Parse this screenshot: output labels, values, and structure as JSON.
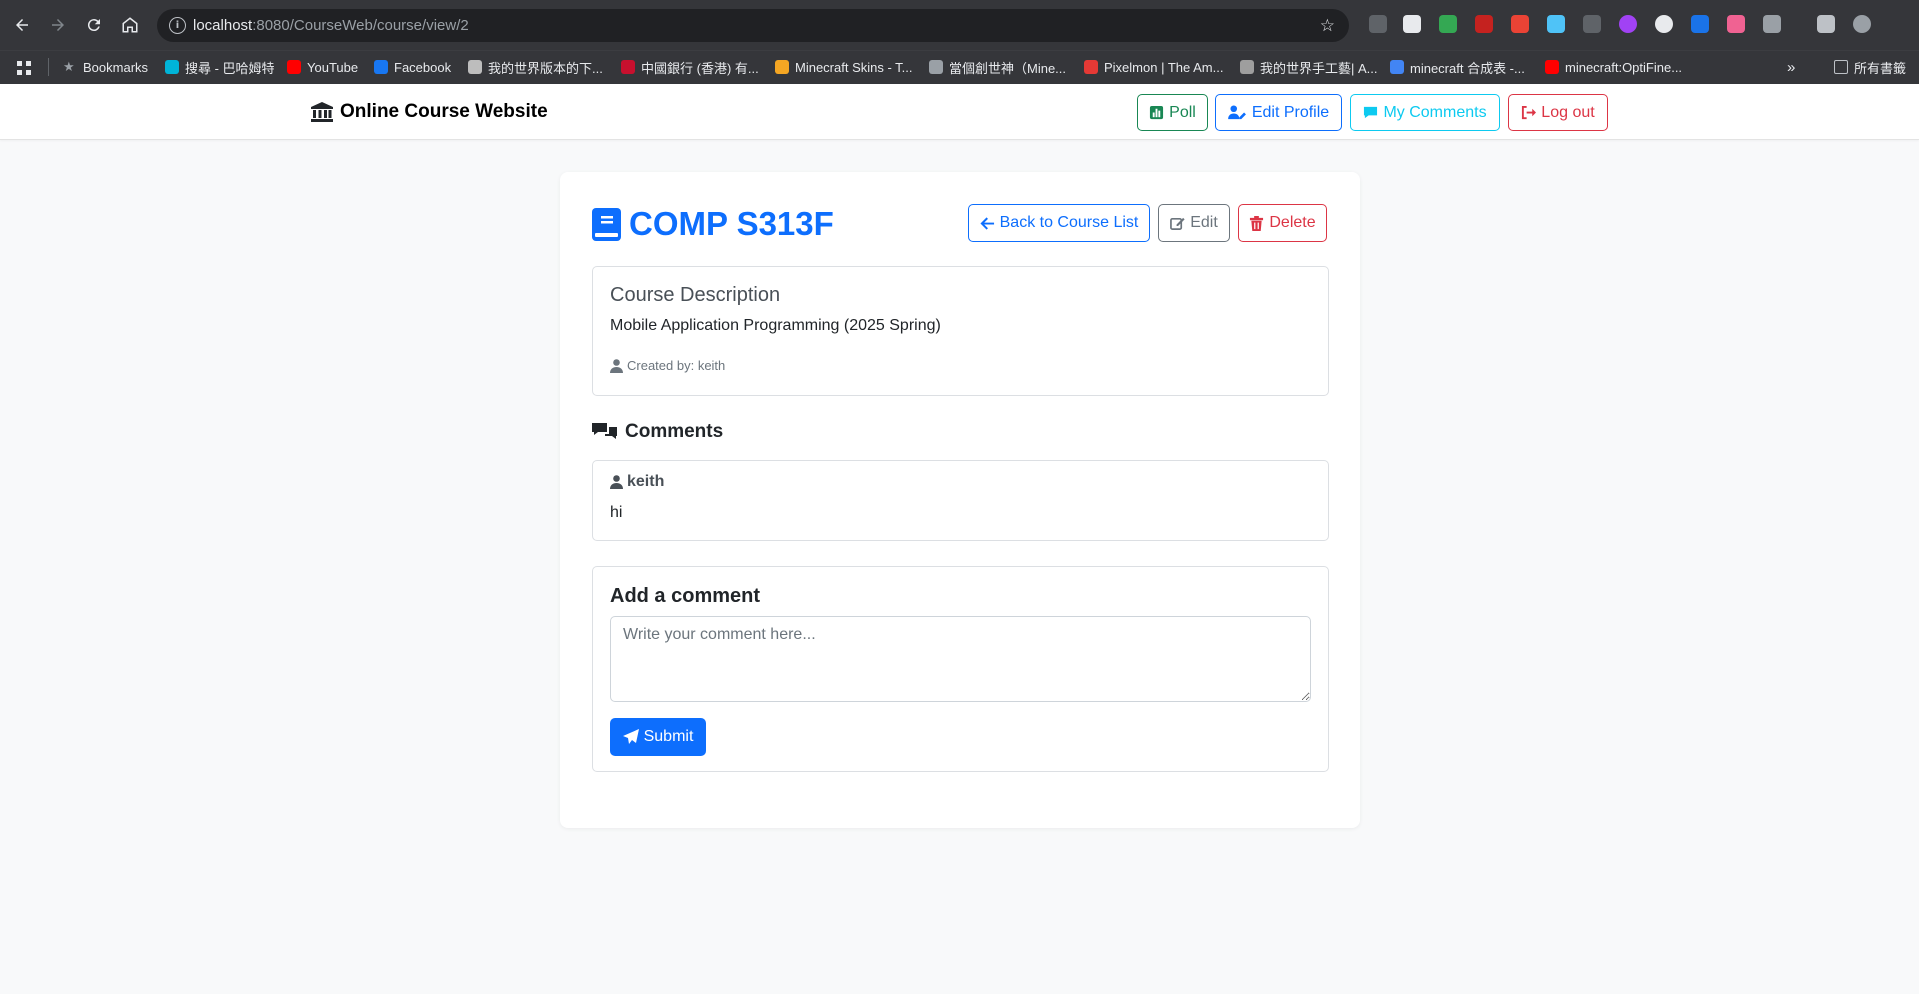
{
  "browser": {
    "url_host": "localhost",
    "url_path": ":8080/CourseWeb/course/view/2",
    "bookmarks": [
      {
        "label": "Bookmarks",
        "color": "#9aa0a6"
      },
      {
        "label": "搜尋 - 巴哈姆特",
        "color": "#00b4d8"
      },
      {
        "label": "YouTube",
        "color": "#ff0000"
      },
      {
        "label": "Facebook",
        "color": "#1877f2"
      },
      {
        "label": "我的世界版本的下...",
        "color": "#bdbdbd"
      },
      {
        "label": "中國銀行 (香港) 有...",
        "color": "#c8102e"
      },
      {
        "label": "Minecraft Skins - T...",
        "color": "#f5a623"
      },
      {
        "label": "當個創世神（Mine...",
        "color": "#9aa0a6"
      },
      {
        "label": "Pixelmon | The Am...",
        "color": "#e53935"
      },
      {
        "label": "我的世界手工藝| A...",
        "color": "#9e9e9e"
      },
      {
        "label": "minecraft 合成表 -...",
        "color": "#4285f4"
      },
      {
        "label": "minecraft:OptiFine...",
        "color": "#ff0000"
      }
    ],
    "all_bookmarks_label": "所有書籤"
  },
  "navbar": {
    "brand": "Online Course Website",
    "poll_label": "Poll",
    "edit_profile_label": "Edit Profile",
    "my_comments_label": "My Comments",
    "logout_label": "Log out"
  },
  "course": {
    "title": "COMP S313F",
    "back_label": "Back to Course List",
    "edit_label": "Edit",
    "delete_label": "Delete",
    "description_heading": "Course Description",
    "description": "Mobile Application Programming (2025 Spring)",
    "created_by": "Created by: keith"
  },
  "comments": {
    "heading": "Comments",
    "items": [
      {
        "user": "keith",
        "text": "hi"
      }
    ]
  },
  "add_comment": {
    "heading": "Add a comment",
    "placeholder": "Write your comment here...",
    "submit_label": "Submit"
  },
  "colors": {
    "primary": "#0d6efd",
    "success": "#198754",
    "info": "#0dcaf0",
    "danger": "#dc3545",
    "secondary": "#6c757d"
  }
}
